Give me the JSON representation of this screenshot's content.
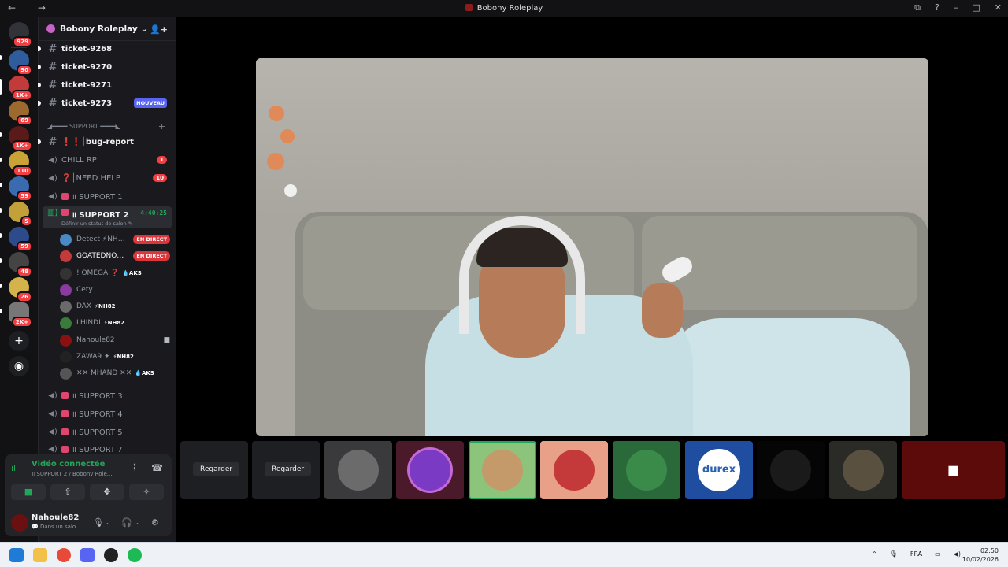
{
  "window": {
    "title": "Bobony Roleplay",
    "nav_icons": "← →",
    "controls": [
      "⧉",
      "?",
      "–",
      "□",
      "✕"
    ]
  },
  "servers": [
    {
      "badge": "929",
      "color": "#3a3a3a"
    },
    {
      "badge": "90",
      "color": "#2f5c9c"
    },
    {
      "badge": "1K+",
      "color": "#c23a3a"
    },
    {
      "badge": "69",
      "color": "#9c6a2f"
    },
    {
      "badge": "1K+",
      "color": "#5b1a1a"
    },
    {
      "badge": "110",
      "color": "#c9a336"
    },
    {
      "badge": "59",
      "color": "#3a6ab0"
    },
    {
      "badge": "5",
      "color": "#c2a13a"
    },
    {
      "badge": "59",
      "color": "#2d4a8a"
    },
    {
      "badge": "48",
      "color": "#444"
    },
    {
      "badge": "26",
      "color": "#d4b44a"
    },
    {
      "badge": "2K+",
      "color": "#777"
    }
  ],
  "guild": {
    "name": "Bobony Roleplay",
    "chevron": "⌄",
    "invite_icon": "👤+"
  },
  "channels": {
    "tickets": [
      {
        "name": "ticket-9268",
        "bright": true
      },
      {
        "name": "ticket-9270",
        "bright": true
      },
      {
        "name": "ticket-9271",
        "bright": true
      },
      {
        "name": "ticket-9273",
        "bright": true,
        "badge": "NOUVEAU"
      }
    ],
    "category": "◢━━━━ SUPPORT ━━━━◣",
    "bug_report": "❗❗│bug-report",
    "chill": {
      "name": "CHILL RP",
      "count": "1"
    },
    "need_help": {
      "name": "❓│NEED HELP",
      "count": "10"
    },
    "support1": "॥ SUPPORT 1",
    "support2": {
      "name": "॥ SUPPORT 2",
      "timer": "4:40:25",
      "status": "Définir un statut de salon ✎"
    },
    "voice_users": [
      {
        "name": "Detect ⚡NH…",
        "live": "EN DIRECT",
        "color": "#4a8ac4"
      },
      {
        "name": "GOATEDNO…",
        "live": "EN DIRECT",
        "color": "#c43a3a"
      },
      {
        "name": "! OMEGA ❓",
        "tag": "💧AKS",
        "color": "#333"
      },
      {
        "name": "Cety",
        "color": "#8a3aa0"
      },
      {
        "name": "DAX",
        "tag": "⚡NH82",
        "color": "#6a6a6a"
      },
      {
        "name": "LHINDI",
        "tag": "⚡NH82",
        "color": "#3a7a3a"
      },
      {
        "name": "Nahoule82",
        "cam": "■",
        "color": "#8b1010"
      },
      {
        "name": "ZAWA9 ✦",
        "tag": "⚡NH82",
        "color": "#222"
      },
      {
        "name": "✕✕ MHAND ✕✕",
        "tag": "💧AKS",
        "color": "#555"
      }
    ],
    "more_support": [
      "॥ SUPPORT 3",
      "॥ SUPPORT 4",
      "॥ SUPPORT 5",
      "॥ SUPPORT 7"
    ]
  },
  "voice_panel": {
    "status": "Vidéo connectée",
    "sub": "॥ SUPPORT 2 / Bobony Role...",
    "buttons": [
      "■",
      "⇧",
      "✥",
      "✧"
    ]
  },
  "user": {
    "name": "Nahoule82",
    "status": "💬 Dans un salo..."
  },
  "strip": {
    "regarder": "Regarder",
    "durex": "durex",
    "cam_icon": "■"
  },
  "taskbar": {
    "lang": "FRA",
    "time": "02:50",
    "date": "10/02/2026"
  }
}
